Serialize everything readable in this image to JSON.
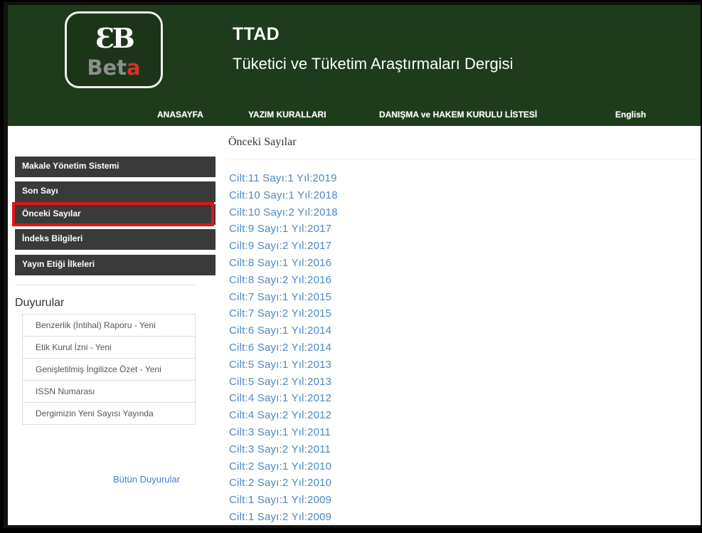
{
  "header": {
    "logo_mark": "ƐB",
    "logo_text_a": "Bet",
    "logo_text_b": "a",
    "title": "TTAD",
    "subtitle": "Tüketici ve Tüketim Araştırmaları Dergisi"
  },
  "nav": {
    "items": [
      "ANASAYFA",
      "YAZIM KURALLARI",
      "DANIŞMA ve HAKEM KURULU LİSTESİ",
      "English"
    ]
  },
  "sidebar": {
    "menu": [
      "Makale Yönetim Sistemi",
      "Son Sayı",
      "Önceki Sayılar",
      "İndeks Bilgileri",
      "Yayın Etiği İlkeleri"
    ],
    "announcements_title": "Duyurular",
    "announcements": [
      "Benzerlik (İntihal) Raporu - Yeni",
      "Etik Kurul İzni - Yeni",
      "Genişletilmiş İngilizce Özet - Yeni",
      "ISSN Numarası",
      "Dergimizin Yeni Sayısı Yayında"
    ],
    "all_announcements": "Bütün Duyurular"
  },
  "main": {
    "title": "Önceki Sayılar",
    "issues": [
      "Cilt:11 Sayı:1 Yıl:2019",
      "Cilt:10 Sayı:1 Yıl:2018",
      "Cilt:10 Sayı:2 Yıl:2018",
      "Cilt:9 Sayı:1 Yıl:2017",
      "Cilt:9 Sayı:2 Yıl:2017",
      "Cilt:8 Sayı:1 Yıl:2016",
      "Cilt:8 Sayı:2 Yıl:2016",
      "Cilt:7 Sayı:1 Yıl:2015",
      "Cilt:7 Sayı:2 Yıl:2015",
      "Cilt:6 Sayı:1 Yıl:2014",
      "Cilt:6 Sayı:2 Yıl:2014",
      "Cilt:5 Sayı:1 Yıl:2013",
      "Cilt:5 Sayı:2 Yıl:2013",
      "Cilt:4 Sayı:1 Yıl:2012",
      "Cilt:4 Sayı:2 Yıl:2012",
      "Cilt:3 Sayı:1 Yıl:2011",
      "Cilt:3 Sayı:2 Yıl:2011",
      "Cilt:2 Sayı:1 Yıl:2010",
      "Cilt:2 Sayı:2 Yıl:2010",
      "Cilt:1 Sayı:1 Yıl:2009",
      "Cilt:1 Sayı:2 Yıl:2009"
    ]
  },
  "colors": {
    "header_bg": "#1e3b1c",
    "menu_bg": "#3a3a3a",
    "link": "#4e88c6",
    "highlight": "#e3141b"
  }
}
